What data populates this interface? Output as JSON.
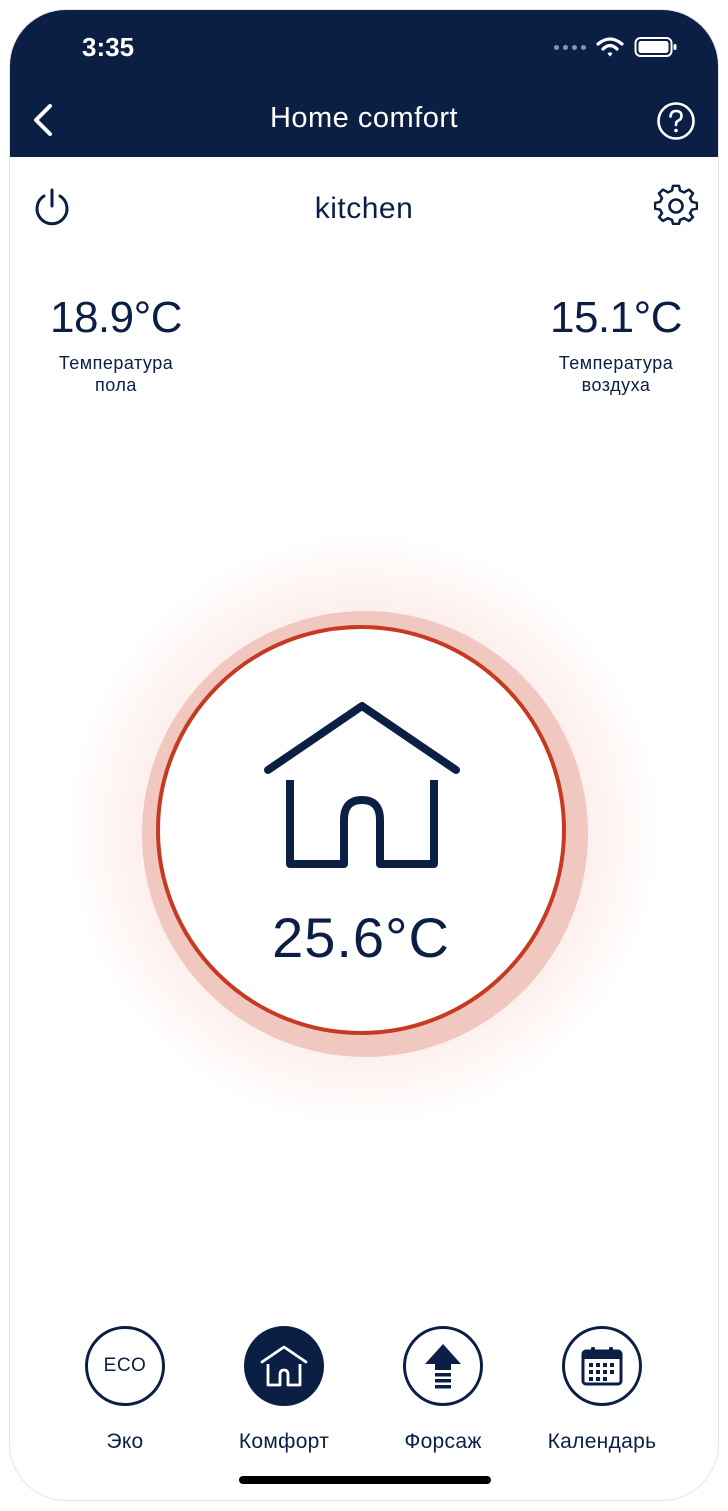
{
  "status_bar": {
    "time": "3:35"
  },
  "nav": {
    "title": "Home comfort"
  },
  "room": {
    "name": "kitchen"
  },
  "readings": {
    "floor": {
      "value": "18.9°C",
      "label_line1": "Температура",
      "label_line2": "пола"
    },
    "air": {
      "value": "15.1°C",
      "label_line1": "Температура",
      "label_line2": "воздуха"
    }
  },
  "dial": {
    "temperature": "25.6°C",
    "mode_icon": "home-icon"
  },
  "modes": [
    {
      "label": "Эко",
      "icon_text": "ECO",
      "active": false
    },
    {
      "label": "Комфорт",
      "icon": "home-icon",
      "active": true
    },
    {
      "label": "Форсаж",
      "icon": "boost-arrow-icon",
      "active": false
    },
    {
      "label": "Календарь",
      "icon": "calendar-icon",
      "active": false
    }
  ],
  "colors": {
    "navy": "#0b1f45",
    "accent_red": "#c63a22",
    "ring": "#f1c8c0"
  }
}
